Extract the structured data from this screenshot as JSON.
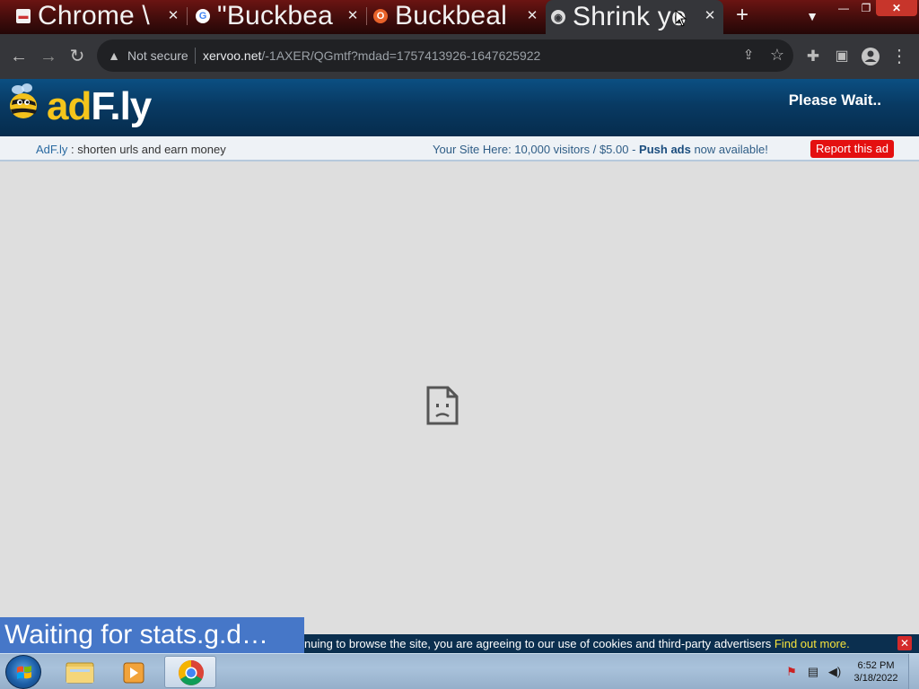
{
  "browser": {
    "tabs": [
      {
        "title": "Chrome \\",
        "favicon": "chrome-web-store-icon"
      },
      {
        "title": "\"Buckbea",
        "favicon": "google-icon"
      },
      {
        "title": "Buckbeal",
        "favicon": "opera-icon"
      },
      {
        "title": "Shrink yo",
        "favicon": "globe-icon",
        "active": true
      }
    ],
    "new_tab": "+",
    "address": {
      "security_label": "Not secure",
      "host": "xervoo.net",
      "path": "/-1AXER/QGmtf?mdad=1757413926-1647625922"
    }
  },
  "adfly": {
    "logo": {
      "ad": "ad",
      "f": "F",
      "ly": ".ly"
    },
    "please_wait": "Please Wait..",
    "info_left_brand": "AdF.ly",
    "info_left_rest": " : shorten urls and earn money",
    "info_right_pre": "Your Site Here: 10,000 visitors / $5.00 - ",
    "info_right_bold": "Push ads",
    "info_right_post": " now available!",
    "report_button": "Report this ad"
  },
  "status_bubble": "Waiting for stats.g.d…",
  "cookie_bar": {
    "text": "nuing to browse the site, you are agreeing to our use of cookies and third-party advertisers ",
    "link": "Find out more.",
    "close": "✕"
  },
  "taskbar": {
    "clock_time": "6:52 PM",
    "clock_date": "3/18/2022"
  },
  "colors": {
    "tabstrip": "#4a0e0d",
    "toolbar": "#35363a",
    "adfly_header": "#083a63",
    "report_red": "#e41010",
    "status_blue": "#4677c8",
    "cookie_link": "#f5e23b"
  }
}
